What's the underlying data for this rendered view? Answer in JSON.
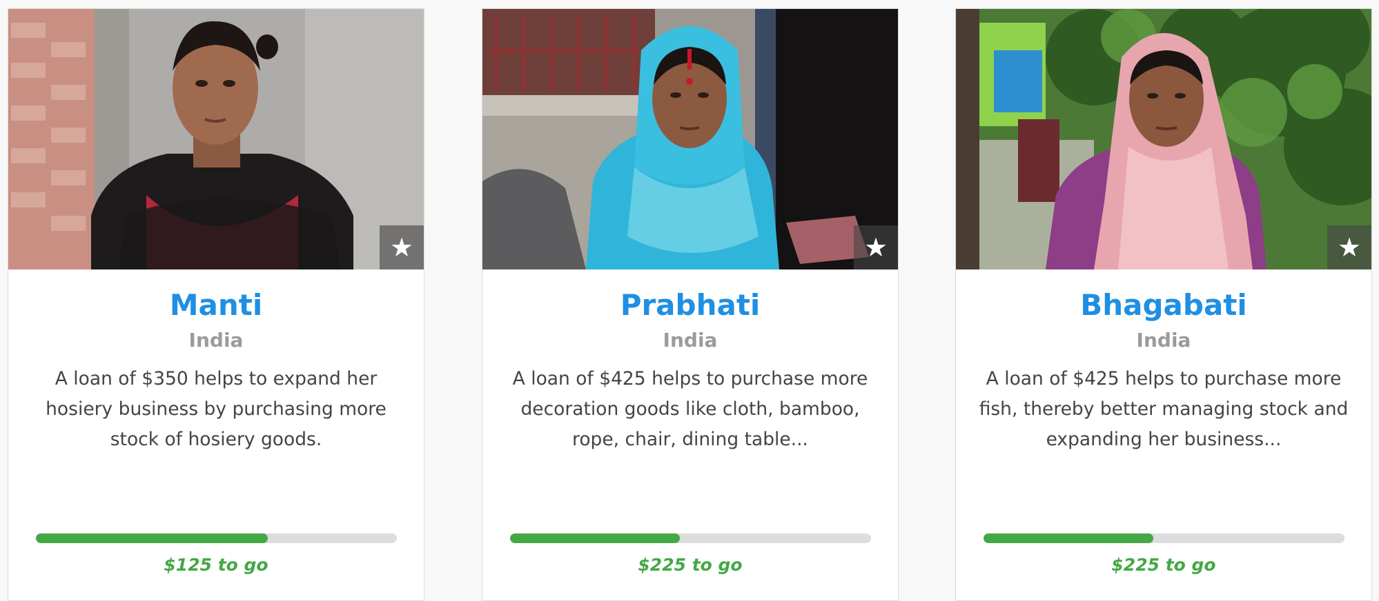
{
  "loans": [
    {
      "name": "Manti",
      "country": "India",
      "description": "A loan of $350 helps to expand her hosiery business by purchasing more stock of hosiery goods.",
      "progress_percent": 64.3,
      "to_go": "$125 to go",
      "favorite_icon": "star-icon"
    },
    {
      "name": "Prabhati",
      "country": "India",
      "description": "A loan of $425 helps to purchase more decoration goods like cloth, bamboo, rope, chair, dining table...",
      "progress_percent": 47.1,
      "to_go": "$225 to go",
      "favorite_icon": "star-icon"
    },
    {
      "name": "Bhagabati",
      "country": "India",
      "description": "A loan of $425 helps to purchase more fish, thereby better managing stock and expanding her business...",
      "progress_percent": 47.1,
      "to_go": "$225 to go",
      "favorite_icon": "star-icon"
    }
  ],
  "colors": {
    "name_link": "#1f8fe3",
    "country": "#9b9b9b",
    "progress_fill": "#44a845",
    "progress_track": "#dddddd"
  }
}
